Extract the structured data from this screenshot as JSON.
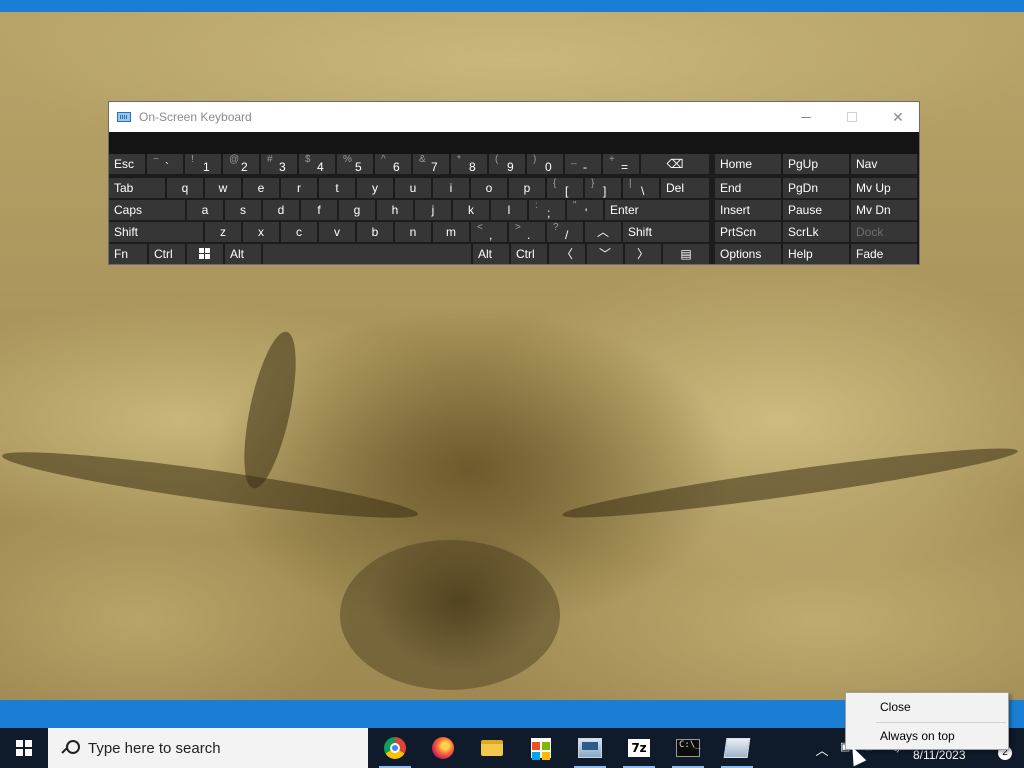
{
  "osk": {
    "title": "On-Screen Keyboard",
    "rows": [
      [
        {
          "id": "esc",
          "label": "Esc"
        },
        {
          "id": "tilde",
          "sub": "~",
          "main": "`"
        },
        {
          "id": "k1",
          "sub": "!",
          "main": "1"
        },
        {
          "id": "k2",
          "sub": "@",
          "main": "2"
        },
        {
          "id": "k3",
          "sub": "#",
          "main": "3"
        },
        {
          "id": "k4",
          "sub": "$",
          "main": "4"
        },
        {
          "id": "k5",
          "sub": "%",
          "main": "5"
        },
        {
          "id": "k6",
          "sub": "^",
          "main": "6"
        },
        {
          "id": "k7",
          "sub": "&",
          "main": "7"
        },
        {
          "id": "k8",
          "sub": "*",
          "main": "8"
        },
        {
          "id": "k9",
          "sub": "(",
          "main": "9"
        },
        {
          "id": "k0",
          "sub": ")",
          "main": "0"
        },
        {
          "id": "minus",
          "sub": "_",
          "main": "-"
        },
        {
          "id": "equals",
          "sub": "+",
          "main": "="
        },
        {
          "id": "backspace",
          "label": "⌫"
        }
      ],
      [
        {
          "id": "tab",
          "label": "Tab"
        },
        {
          "id": "q",
          "label": "q"
        },
        {
          "id": "w",
          "label": "w"
        },
        {
          "id": "e",
          "label": "e"
        },
        {
          "id": "r",
          "label": "r"
        },
        {
          "id": "t",
          "label": "t"
        },
        {
          "id": "y",
          "label": "y"
        },
        {
          "id": "u",
          "label": "u"
        },
        {
          "id": "i",
          "label": "i"
        },
        {
          "id": "o",
          "label": "o"
        },
        {
          "id": "p",
          "label": "p"
        },
        {
          "id": "lbracket",
          "sub": "{",
          "main": "["
        },
        {
          "id": "rbracket",
          "sub": "}",
          "main": "]"
        },
        {
          "id": "backslash",
          "sub": "|",
          "main": "\\"
        },
        {
          "id": "del",
          "label": "Del"
        }
      ],
      [
        {
          "id": "caps",
          "label": "Caps"
        },
        {
          "id": "a",
          "label": "a"
        },
        {
          "id": "s",
          "label": "s"
        },
        {
          "id": "d",
          "label": "d"
        },
        {
          "id": "f",
          "label": "f"
        },
        {
          "id": "g",
          "label": "g"
        },
        {
          "id": "h",
          "label": "h"
        },
        {
          "id": "j",
          "label": "j"
        },
        {
          "id": "k",
          "label": "k"
        },
        {
          "id": "l",
          "label": "l"
        },
        {
          "id": "semicolon",
          "sub": ":",
          "main": ";"
        },
        {
          "id": "quote",
          "sub": "\"",
          "main": "'"
        },
        {
          "id": "enter",
          "label": "Enter"
        }
      ],
      [
        {
          "id": "lshift",
          "label": "Shift"
        },
        {
          "id": "z",
          "label": "z"
        },
        {
          "id": "x",
          "label": "x"
        },
        {
          "id": "c",
          "label": "c"
        },
        {
          "id": "v",
          "label": "v"
        },
        {
          "id": "b",
          "label": "b"
        },
        {
          "id": "n",
          "label": "n"
        },
        {
          "id": "m",
          "label": "m"
        },
        {
          "id": "comma",
          "sub": "<",
          "main": ","
        },
        {
          "id": "period",
          "sub": ">",
          "main": "."
        },
        {
          "id": "slash",
          "sub": "?",
          "main": "/"
        },
        {
          "id": "up",
          "label": "︿"
        },
        {
          "id": "rshift",
          "label": "Shift"
        }
      ],
      [
        {
          "id": "fn",
          "label": "Fn"
        },
        {
          "id": "lctrl",
          "label": "Ctrl"
        },
        {
          "id": "winkey",
          "label": ""
        },
        {
          "id": "lalt",
          "label": "Alt"
        },
        {
          "id": "space",
          "label": ""
        },
        {
          "id": "ralt",
          "label": "Alt"
        },
        {
          "id": "rctrl",
          "label": "Ctrl"
        },
        {
          "id": "left",
          "label": "〈"
        },
        {
          "id": "down",
          "label": "﹀"
        },
        {
          "id": "right",
          "label": "〉"
        },
        {
          "id": "menu",
          "label": "▤"
        }
      ]
    ],
    "nav_keys": [
      [
        "Home",
        "PgUp",
        "Nav"
      ],
      [
        "End",
        "PgDn",
        "Mv Up"
      ],
      [
        "Insert",
        "Pause",
        "Mv Dn"
      ],
      [
        "PrtScn",
        "ScrLk",
        "Dock"
      ],
      [
        "Options",
        "Help",
        "Fade"
      ]
    ]
  },
  "taskbar": {
    "search_placeholder": "Type here to search",
    "apps": [
      "chrome-icon",
      "firefox-icon",
      "file-explorer-icon",
      "store-icon",
      "network-icon",
      "7zip-icon",
      "terminal-icon",
      "remote-desktop-icon"
    ],
    "date": "8/11/2023",
    "notification_count": "2"
  },
  "context_menu": {
    "items": [
      "Close",
      "Always on top"
    ]
  }
}
